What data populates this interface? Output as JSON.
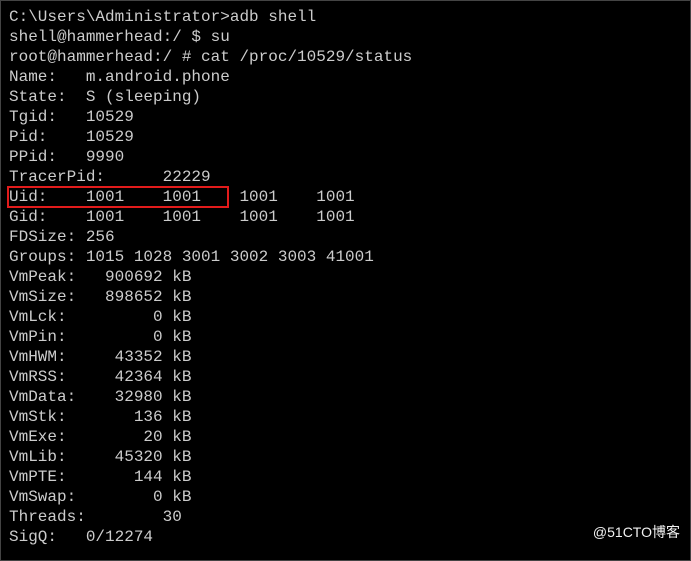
{
  "header_fragment": "",
  "prompt1_prefix": "C:\\Users\\Administrator>",
  "cmd1": "adb shell",
  "prompt2_prefix": "shell@hammerhead:/ $ ",
  "cmd2": "su",
  "prompt3_prefix": "root@hammerhead:/ # ",
  "cmd3": "cat /proc/10529/status",
  "status": {
    "Name": "Name:   m.android.phone",
    "State": "State:  S (sleeping)",
    "Tgid": "Tgid:   10529",
    "Pid": "Pid:    10529",
    "PPid": "PPid:   9990",
    "TracerPid": "TracerPid:      22229",
    "Uid": "Uid:    1001    1001    1001    1001",
    "Gid": "Gid:    1001    1001    1001    1001",
    "FDSize": "FDSize: 256",
    "Groups": "Groups: 1015 1028 3001 3002 3003 41001",
    "VmPeak": "VmPeak:   900692 kB",
    "VmSize": "VmSize:   898652 kB",
    "VmLck": "VmLck:         0 kB",
    "VmPin": "VmPin:         0 kB",
    "VmHWM": "VmHWM:     43352 kB",
    "VmRSS": "VmRSS:     42364 kB",
    "VmData": "VmData:    32980 kB",
    "VmStk": "VmStk:       136 kB",
    "VmExe": "VmExe:        20 kB",
    "VmLib": "VmLib:     45320 kB",
    "VmPTE": "VmPTE:       144 kB",
    "VmSwap": "VmSwap:        0 kB",
    "Threads": "Threads:        30",
    "SigQ": "SigQ:   0/12274"
  },
  "watermark": "@51CTO博客"
}
